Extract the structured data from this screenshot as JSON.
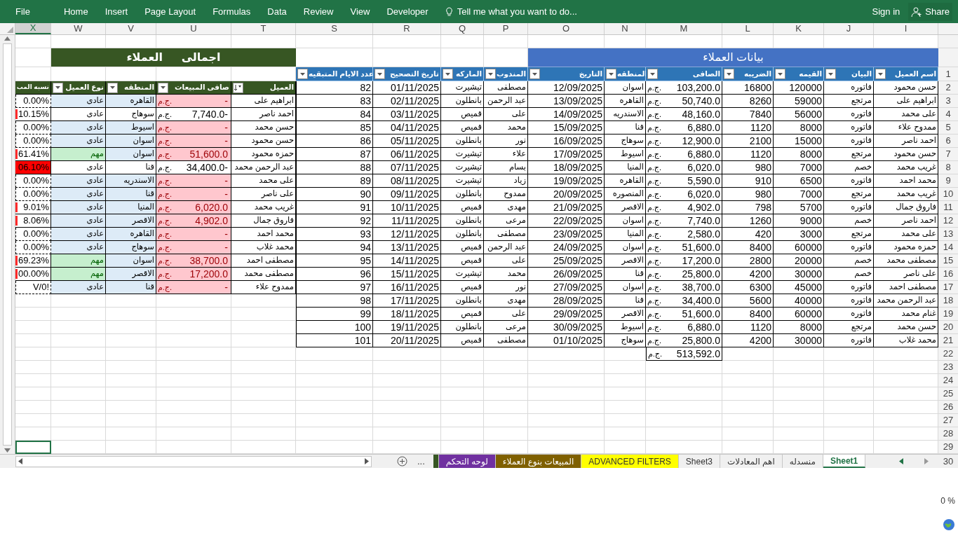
{
  "ribbon": {
    "tabs": [
      "Developer",
      "View",
      "Review",
      "Data",
      "Formulas",
      "Page Layout",
      "Insert",
      "Home",
      "File"
    ],
    "tell_me": "Tell me what you want to do...",
    "sign_in": "Sign in",
    "share": "Share"
  },
  "column_letters": [
    {
      "label": "I",
      "selected": false
    },
    {
      "label": "J",
      "selected": false
    },
    {
      "label": "K",
      "selected": false
    },
    {
      "label": "L",
      "selected": false
    },
    {
      "label": "M",
      "selected": false
    },
    {
      "label": "N",
      "selected": false
    },
    {
      "label": "O",
      "selected": false
    },
    {
      "label": "P",
      "selected": false
    },
    {
      "label": "Q",
      "selected": false
    },
    {
      "label": "R",
      "selected": false
    },
    {
      "label": "S",
      "selected": false
    },
    {
      "label": "T",
      "selected": false
    },
    {
      "label": "U",
      "selected": false
    },
    {
      "label": "V",
      "selected": false
    },
    {
      "label": "W",
      "selected": false
    },
    {
      "label": "X",
      "selected": true
    }
  ],
  "left_table": {
    "title": "اجمالى      العملاء",
    "columns": [
      {
        "label": "العميل",
        "sorted": true
      },
      {
        "label": "صافى المبيعات",
        "sorted": false
      },
      {
        "label": "المنطقه",
        "sorted": false
      },
      {
        "label": "نوع العميل",
        "sorted": false
      },
      {
        "label": "نسبه المب"
      }
    ],
    "rows": [
      {
        "client": "ابراهيم على",
        "net": "-",
        "currency": "ج.م.",
        "region": "القاهره",
        "type": "عادى",
        "ratio": "0.00%",
        "highlight": true,
        "important": false,
        "data_bar": false,
        "overflow": false
      },
      {
        "client": "احمد ناصر",
        "net": "7,740.0-",
        "currency": "ج.م.",
        "region": "سوهاج",
        "type": "عادى",
        "ratio": "10.15%",
        "highlight": false,
        "important": false,
        "data_bar": true,
        "overflow": false
      },
      {
        "client": "حسن محمد",
        "net": "-",
        "currency": "ج.م.",
        "region": "اسيوط",
        "type": "عادى",
        "ratio": "0.00%",
        "highlight": true,
        "important": false,
        "data_bar": false,
        "overflow": false
      },
      {
        "client": "حسن محمود",
        "net": "-",
        "currency": "ج.م.",
        "region": "اسوان",
        "type": "عادى",
        "ratio": "0.00%",
        "highlight": true,
        "important": false,
        "data_bar": false,
        "overflow": false
      },
      {
        "client": "حمزه محمود",
        "net": "51,600.0",
        "currency": "ج.م.",
        "region": "اسوان",
        "type": "مهم",
        "ratio": "61.41%",
        "highlight": true,
        "important": true,
        "data_bar": true,
        "overflow": false
      },
      {
        "client": "عبد الرحمن محمد",
        "net": "34,400.0-",
        "currency": "ج.م.",
        "region": "قنا",
        "type": "عادى",
        "ratio": "06.10%",
        "highlight": false,
        "important": false,
        "data_bar": true,
        "overflow": true
      },
      {
        "client": "على محمد",
        "net": "-",
        "currency": "ج.م.",
        "region": "الاسندريه",
        "type": "عادى",
        "ratio": "0.00%",
        "highlight": true,
        "important": false,
        "data_bar": false,
        "overflow": false
      },
      {
        "client": "على ناصر",
        "net": "-",
        "currency": "ج.م.",
        "region": "قنا",
        "type": "عادى",
        "ratio": "0.00%",
        "highlight": true,
        "important": false,
        "data_bar": false,
        "overflow": false
      },
      {
        "client": "غريب محمد",
        "net": "6,020.0",
        "currency": "ج.م.",
        "region": "المنيا",
        "type": "عادى",
        "ratio": "9.01%",
        "highlight": true,
        "important": false,
        "data_bar": true,
        "overflow": false
      },
      {
        "client": "فاروق جمال",
        "net": "4,902.0",
        "currency": "ج.م.",
        "region": "الاقصر",
        "type": "عادى",
        "ratio": "8.06%",
        "highlight": true,
        "important": false,
        "data_bar": true,
        "overflow": false
      },
      {
        "client": "محمد احمد",
        "net": "-",
        "currency": "ج.م.",
        "region": "القاهره",
        "type": "عادى",
        "ratio": "0.00%",
        "highlight": true,
        "important": false,
        "data_bar": false,
        "overflow": false
      },
      {
        "client": "محمد غلاب",
        "net": "-",
        "currency": "ج.م.",
        "region": "سوهاج",
        "type": "عادى",
        "ratio": "0.00%",
        "highlight": true,
        "important": false,
        "data_bar": false,
        "overflow": false
      },
      {
        "client": "مصطفى احمد",
        "net": "38,700.0",
        "currency": "ج.م.",
        "region": "اسوان",
        "type": "مهم",
        "ratio": "69.23%",
        "highlight": true,
        "important": true,
        "data_bar": true,
        "overflow": false
      },
      {
        "client": "مصطفى محمد",
        "net": "17,200.0",
        "currency": "ج.م.",
        "region": "الاقصر",
        "type": "مهم",
        "ratio": "00.00%",
        "highlight": true,
        "important": true,
        "data_bar": true,
        "overflow": false
      },
      {
        "client": "ممدوح علاء",
        "net": "-",
        "currency": "ج.م.",
        "region": "قنا",
        "type": "عادى",
        "ratio": "V/0!",
        "highlight": true,
        "important": false,
        "data_bar": false,
        "overflow": false
      }
    ]
  },
  "right_table": {
    "title": "بيانات العملاء",
    "columns": [
      "اسم العميل",
      "البيان",
      "القيمه",
      "الضريبه",
      "الصافى",
      "المنطقه",
      "التاريخ",
      "المندوب",
      "الماركه",
      "تاريخ التصحيح",
      "عدد الايام المتبقيه"
    ],
    "rows": [
      {
        "cells": [
          "حسن محمود",
          "فاتوره",
          "120000",
          "16800",
          "103,200.0",
          "اسوان",
          "12/09/2025",
          "مصطفى",
          "تيشيرت",
          "01/11/2025",
          "82"
        ],
        "currency": "ج.م."
      },
      {
        "cells": [
          "ابراهيم على",
          "مرتجع",
          "59000",
          "8260",
          "50,740.0",
          "القاهره",
          "13/09/2025",
          "عبد الرحمن",
          "بانطلون",
          "02/11/2025",
          "83"
        ],
        "currency": "ج.م."
      },
      {
        "cells": [
          "على محمد",
          "فاتوره",
          "56000",
          "7840",
          "48,160.0",
          "الاسندريه",
          "14/09/2025",
          "على",
          "قميص",
          "03/11/2025",
          "84"
        ],
        "currency": "ج.م."
      },
      {
        "cells": [
          "ممدوح علاء",
          "فاتوره",
          "8000",
          "1120",
          "6,880.0",
          "قنا",
          "15/09/2025",
          "محمد",
          "قميص",
          "04/11/2025",
          "85"
        ],
        "currency": "ج.م."
      },
      {
        "cells": [
          "احمد ناصر",
          "فاتوره",
          "15000",
          "2100",
          "12,900.0",
          "سوهاج",
          "16/09/2025",
          "نور",
          "بانطلون",
          "05/11/2025",
          "86"
        ],
        "currency": "ج.م."
      },
      {
        "cells": [
          "حسن محمود",
          "مرتجع",
          "8000",
          "1120",
          "6,880.0",
          "اسيوط",
          "17/09/2025",
          "علاء",
          "تيشيرت",
          "06/11/2025",
          "87"
        ],
        "currency": "ج.م."
      },
      {
        "cells": [
          "غريب محمد",
          "خصم",
          "7000",
          "980",
          "6,020.0",
          "المنيا",
          "18/09/2025",
          "بسام",
          "تيشيرت",
          "07/11/2025",
          "88"
        ],
        "currency": "ج.م."
      },
      {
        "cells": [
          "محمد احمد",
          "فاتوره",
          "6500",
          "910",
          "5,590.0",
          "القاهره",
          "19/09/2025",
          "زياد",
          "تيشيرت",
          "08/11/2025",
          "89"
        ],
        "currency": "ج.م."
      },
      {
        "cells": [
          "غريب محمد",
          "مرتجع",
          "7000",
          "980",
          "6,020.0",
          "المنصوره",
          "20/09/2025",
          "ممدوح",
          "بانطلون",
          "09/11/2025",
          "90"
        ],
        "currency": "ج.م."
      },
      {
        "cells": [
          "فاروق جمال",
          "فاتوره",
          "5700",
          "798",
          "4,902.0",
          "الاقصر",
          "21/09/2025",
          "مهدى",
          "قميص",
          "10/11/2025",
          "91"
        ],
        "currency": "ج.م."
      },
      {
        "cells": [
          "احمد ناصر",
          "خصم",
          "9000",
          "1260",
          "7,740.0",
          "اسوان",
          "22/09/2025",
          "مرعى",
          "بانطلون",
          "11/11/2025",
          "92"
        ],
        "currency": "ج.م."
      },
      {
        "cells": [
          "على محمد",
          "مرتجع",
          "3000",
          "420",
          "2,580.0",
          "المنيا",
          "23/09/2025",
          "مصطفى",
          "بانطلون",
          "12/11/2025",
          "93"
        ],
        "currency": "ج.م."
      },
      {
        "cells": [
          "حمزه محمود",
          "فاتوره",
          "60000",
          "8400",
          "51,600.0",
          "اسوان",
          "24/09/2025",
          "عبد الرحمن",
          "قميص",
          "13/11/2025",
          "94"
        ],
        "currency": "ج.م."
      },
      {
        "cells": [
          "مصطفى محمد",
          "خصم",
          "20000",
          "2800",
          "17,200.0",
          "الاقصر",
          "25/09/2025",
          "على",
          "قميص",
          "14/11/2025",
          "95"
        ],
        "currency": "ج.م."
      },
      {
        "cells": [
          "على ناصر",
          "خصم",
          "30000",
          "4200",
          "25,800.0",
          "قنا",
          "26/09/2025",
          "محمد",
          "تيشيرت",
          "15/11/2025",
          "96"
        ],
        "currency": "ج.م."
      },
      {
        "cells": [
          "مصطفى احمد",
          "فاتوره",
          "45000",
          "6300",
          "38,700.0",
          "اسوان",
          "27/09/2025",
          "نور",
          "قميص",
          "16/11/2025",
          "97"
        ],
        "currency": "ج.م."
      },
      {
        "cells": [
          "عبد الرحمن محمد",
          "فاتوره",
          "40000",
          "5600",
          "34,400.0",
          "قنا",
          "28/09/2025",
          "مهدى",
          "بانطلون",
          "17/11/2025",
          "98"
        ],
        "currency": "ج.م."
      },
      {
        "cells": [
          "غنام محمد",
          "فاتوره",
          "60000",
          "8400",
          "51,600.0",
          "الاقصر",
          "29/09/2025",
          "على",
          "قميص",
          "18/11/2025",
          "99"
        ],
        "currency": "ج.م."
      },
      {
        "cells": [
          "حسن محمد",
          "مرتجع",
          "8000",
          "1120",
          "6,880.0",
          "اسيوط",
          "30/09/2025",
          "مرعى",
          "بانطلون",
          "19/11/2025",
          "100"
        ],
        "currency": "ج.م."
      },
      {
        "cells": [
          "محمد غلاب",
          "فاتوره",
          "30000",
          "4200",
          "25,800.0",
          "سوهاج",
          "01/10/2025",
          "مصطفى",
          "قميص",
          "20/11/2025",
          "101"
        ],
        "currency": "ج.م."
      }
    ],
    "total": {
      "value": "513,592.0",
      "currency": "ج.م."
    }
  },
  "row_numbers": [
    "1",
    "2",
    "3",
    "4",
    "5",
    "6",
    "7",
    "8",
    "9",
    "10",
    "11",
    "12",
    "13",
    "14",
    "15",
    "16",
    "17",
    "18",
    "19",
    "20",
    "21",
    "22",
    "23",
    "24",
    "25",
    "26",
    "27",
    "28",
    "29",
    "30"
  ],
  "sheet_bar": {
    "more": "...",
    "tabs": [
      {
        "label": "Sheet1",
        "selected": true
      },
      {
        "label": "منسدله",
        "selected": false
      },
      {
        "label": "اهم المعادلات",
        "selected": false
      },
      {
        "label": "Sheet3",
        "selected": false
      },
      {
        "label": "ADVANCED FILTERS",
        "color": "#ffff00",
        "selected": false
      },
      {
        "label": "المبيعات بنوع العملاء",
        "color": "#7f6000",
        "selected": false
      },
      {
        "label": "لوحه التحكم",
        "color": "#7030a0",
        "selected": false
      },
      {
        "color": "#375623",
        "selected": false
      }
    ]
  },
  "zoom_fragment": "0 %"
}
